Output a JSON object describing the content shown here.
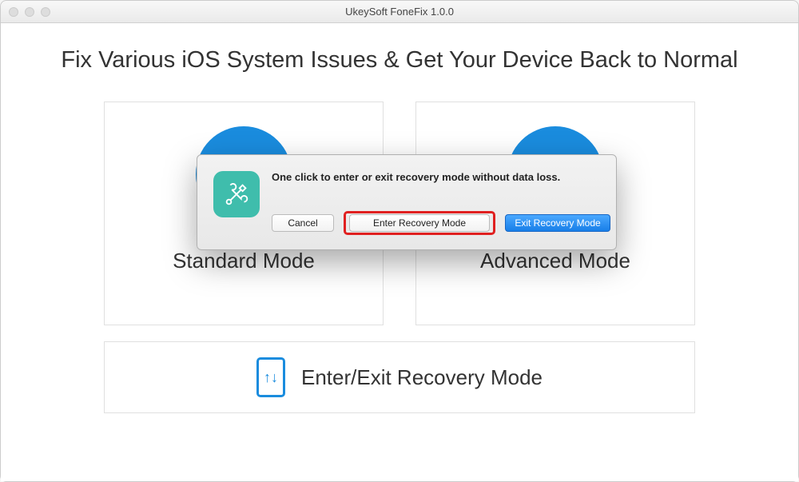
{
  "window": {
    "title": "UkeySoft FoneFix 1.0.0"
  },
  "heading": "Fix Various iOS System Issues & Get Your Device Back to Normal",
  "modes": {
    "standard": {
      "label": "Standard Mode"
    },
    "advanced": {
      "label": "Advanced Mode"
    }
  },
  "bottom": {
    "label": "Enter/Exit Recovery Mode"
  },
  "dialog": {
    "message": "One click to enter or exit recovery mode without data loss.",
    "cancel_label": "Cancel",
    "enter_label": "Enter Recovery Mode",
    "exit_label": "Exit Recovery Mode",
    "icon_name": "tools-icon"
  },
  "colors": {
    "accent_blue": "#1a8cde",
    "dialog_icon_bg": "#3fbdac",
    "highlight_red": "#e02020",
    "button_blue_top": "#4aa8ff",
    "button_blue_bottom": "#187fe8"
  }
}
